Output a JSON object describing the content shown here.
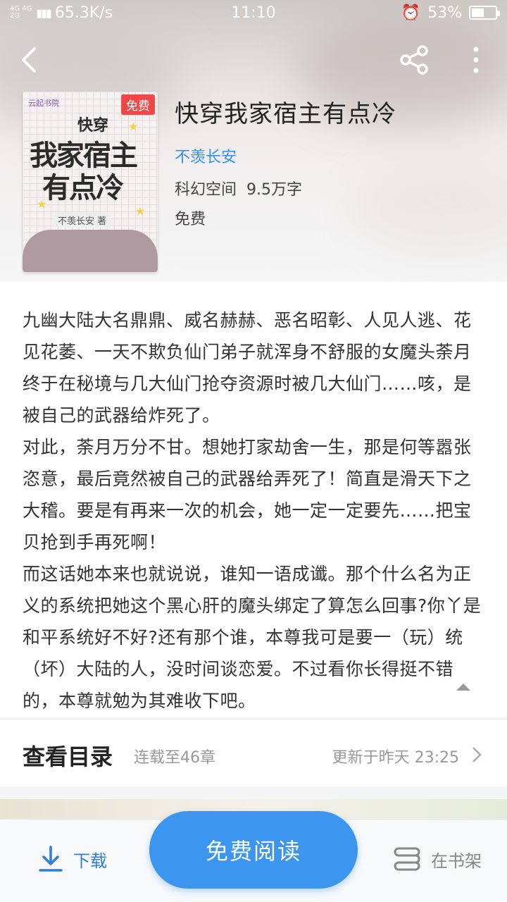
{
  "status_bar": {
    "network": [
      "4G 4G",
      "2G"
    ],
    "speed": "65.3K/s",
    "time": "11:10",
    "battery": "53%",
    "battery_level": 0.53
  },
  "book": {
    "title": "快穿我家宿主有点冷",
    "author": "不羡长安",
    "category": "科幻空间",
    "word_count": "9.5万字",
    "price": "免费",
    "badge": "免费",
    "cover": {
      "publisher": "云起书院",
      "line1": "快穿",
      "line2": "我家宿主",
      "line3": "有点冷",
      "author_tag": "不羡长安 著"
    }
  },
  "description": [
    "九幽大陆大名鼎鼎、威名赫赫、恶名昭彰、人见人逃、花见花萎、一天不欺负仙门弟子就浑身不舒服的女魔头荼月终于在秘境与几大仙门抢夺资源时被几大仙门……咳，是被自己的武器给炸死了。",
    "对此，荼月万分不甘。想她打家劫舍一生，那是何等嚣张恣意，最后竟然被自己的武器给弄死了！简直是滑天下之大稽。要是有再来一次的机会，她一定一定要先……把宝贝抢到手再死啊！",
    "而这话她本来也就说说，谁知一语成谶。那个什么名为正义的系统把她这个黑心肝的魔头绑定了算怎么回事?你丫是和平系统好不好?还有那个谁，本尊我可是要一（玩）统（坏）大陆的人，没时间谈恋爱。不过看你长得挺不错的，本尊就勉为其难收下吧。"
  ],
  "toc": {
    "label": "查看目录",
    "serial": "连载至46章",
    "updated": "更新于昨天 23:25"
  },
  "bottom": {
    "download": "下载",
    "read": "免费阅读",
    "shelf": "在书架"
  },
  "colors": {
    "accent": "#3c95ee",
    "author": "#3b8ee6",
    "badge": "#f04848"
  }
}
